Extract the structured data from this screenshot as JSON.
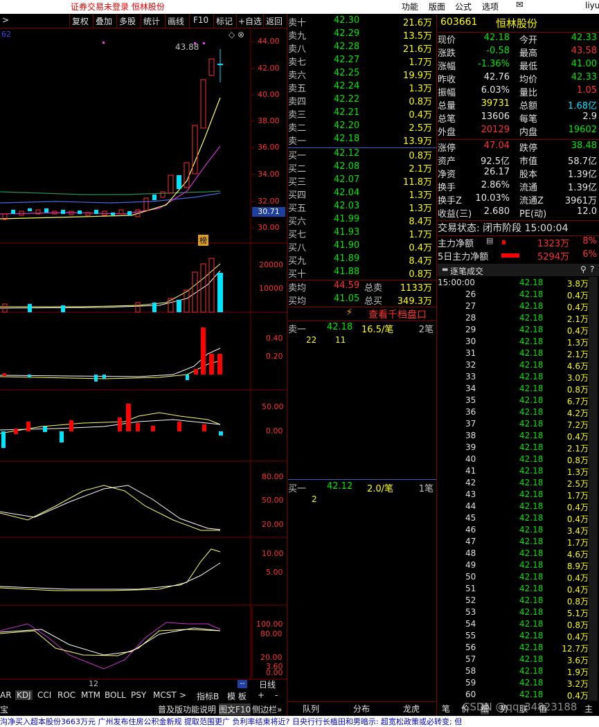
{
  "app": {
    "title": "证券交易未登录  恒林股份",
    "menus": [
      "功能",
      "版面",
      "公式",
      "选项"
    ],
    "user": "liyu"
  },
  "toolbar": {
    "items": [
      ">",
      "复权",
      "叠加",
      "多股",
      "统计",
      "画线",
      "F10",
      "标记",
      "+自选",
      "返回"
    ]
  },
  "chart": {
    "corner_label": "62",
    "price_high_label": "43.88",
    "price_axis": [
      "44.00",
      "42.00",
      "40.00",
      "38.00",
      "36.00",
      "34.00",
      "32.00",
      "30.00"
    ],
    "current_price_tag": "30.71",
    "badge": "榜",
    "volume_axis": [
      "20000",
      "10000"
    ],
    "ind1_axis": [
      "0.40",
      "0.20"
    ],
    "ind2_axis": [
      "50.00",
      "0.00"
    ],
    "ind3_axis": [
      "80.00",
      "50.00",
      "20.00"
    ],
    "ind4_axis": [
      "10.00",
      "5.00"
    ],
    "ind5_axis": [
      "100.00",
      "80.00",
      "20.00",
      "3.60",
      "0.00"
    ],
    "time_label": "12",
    "period_button": "日线",
    "indicator_tabs": [
      "AR",
      "KDJ",
      "CCI",
      "ROC",
      "MTM",
      "BOLL",
      "PSY",
      "MCST",
      ">",
      "指标B",
      "模 板",
      "+",
      "-"
    ],
    "status_tabs": [
      "宝",
      "普及版功能说明",
      "图文F10",
      "侧边栏»"
    ]
  },
  "orderbook": {
    "sell": [
      {
        "label": "卖十",
        "price": "42.30",
        "vol": "21.6万"
      },
      {
        "label": "卖九",
        "price": "42.29",
        "vol": "13.5万"
      },
      {
        "label": "卖八",
        "price": "42.28",
        "vol": "21.6万"
      },
      {
        "label": "卖七",
        "price": "42.27",
        "vol": "1.7万"
      },
      {
        "label": "卖六",
        "price": "42.25",
        "vol": "19.9万"
      },
      {
        "label": "卖五",
        "price": "42.24",
        "vol": "1.3万"
      },
      {
        "label": "卖四",
        "price": "42.22",
        "vol": "0.8万"
      },
      {
        "label": "卖三",
        "price": "42.21",
        "vol": "0.4万"
      },
      {
        "label": "卖二",
        "price": "42.20",
        "vol": "2.5万"
      },
      {
        "label": "卖一",
        "price": "42.18",
        "vol": "13.9万"
      }
    ],
    "buy": [
      {
        "label": "买一",
        "price": "42.12",
        "vol": "0.8万"
      },
      {
        "label": "买二",
        "price": "42.08",
        "vol": "2.1万"
      },
      {
        "label": "买三",
        "price": "42.07",
        "vol": "11.8万"
      },
      {
        "label": "买四",
        "price": "42.04",
        "vol": "1.3万"
      },
      {
        "label": "买五",
        "price": "42.03",
        "vol": "1.3万"
      },
      {
        "label": "买六",
        "price": "41.99",
        "vol": "8.4万"
      },
      {
        "label": "买七",
        "price": "41.93",
        "vol": "1.7万"
      },
      {
        "label": "买八",
        "price": "41.90",
        "vol": "0.4万"
      },
      {
        "label": "买九",
        "price": "41.89",
        "vol": "8.4万"
      },
      {
        "label": "买十",
        "price": "41.88",
        "vol": "0.8万"
      }
    ],
    "sell_avg": {
      "label": "卖均",
      "price": "44.59",
      "total_label": "总卖",
      "total": "1133万"
    },
    "buy_avg": {
      "label": "买均",
      "price": "41.05",
      "total_label": "总买",
      "total": "349.3万"
    },
    "depth_link": "查看千档盘口",
    "sell1_detail": {
      "label": "卖一",
      "price": "42.18",
      "size": "16.5/笔",
      "count": "2笔",
      "orders": [
        "22",
        "11"
      ]
    },
    "buy1_detail": {
      "label": "买一",
      "price": "42.12",
      "size": "2.0/笔",
      "count": "1笔",
      "orders": [
        "2"
      ]
    },
    "tabs": [
      "队列",
      "分布",
      "龙虎"
    ]
  },
  "quote": {
    "code": "603661",
    "name": "恒林股份",
    "rows": [
      [
        {
          "l": "现价",
          "v": "42.18",
          "c": "green"
        },
        {
          "l": "今开",
          "v": "42.33",
          "c": "green"
        }
      ],
      [
        {
          "l": "涨跌",
          "v": "-0.58",
          "c": "green"
        },
        {
          "l": "最高",
          "v": "43.58",
          "c": "red"
        }
      ],
      [
        {
          "l": "涨幅",
          "v": "-1.36%",
          "c": "green"
        },
        {
          "l": "最低",
          "v": "41.00",
          "c": "green"
        }
      ],
      [
        {
          "l": "昨收",
          "v": "42.76",
          "c": "white"
        },
        {
          "l": "均价",
          "v": "42.33",
          "c": "green"
        }
      ],
      [
        {
          "l": "振幅",
          "v": "6.03%",
          "c": "white"
        },
        {
          "l": "量比",
          "v": "1.05",
          "c": "red"
        }
      ],
      [
        {
          "l": "总量",
          "v": "39731",
          "c": "yellow"
        },
        {
          "l": "总额",
          "v": "1.68亿",
          "c": "cyan"
        }
      ],
      [
        {
          "l": "总笔",
          "v": "13606",
          "c": "white"
        },
        {
          "l": "每笔",
          "v": "2.9",
          "c": "white"
        }
      ],
      [
        {
          "l": "外盘",
          "v": "20129",
          "c": "red"
        },
        {
          "l": "内盘",
          "v": "19602",
          "c": "green"
        }
      ],
      [
        {
          "l": "涨停",
          "v": "47.04",
          "c": "red"
        },
        {
          "l": "跌停",
          "v": "38.48",
          "c": "green"
        }
      ],
      [
        {
          "l": "资产",
          "v": "92.5亿",
          "c": "white"
        },
        {
          "l": "市值",
          "v": "58.7亿",
          "c": "white"
        }
      ],
      [
        {
          "l": "净资",
          "v": "26.17",
          "c": "white"
        },
        {
          "l": "股本",
          "v": "1.39亿",
          "c": "white"
        }
      ],
      [
        {
          "l": "换手",
          "v": "2.86%",
          "c": "white"
        },
        {
          "l": "流通",
          "v": "1.39亿",
          "c": "white"
        }
      ],
      [
        {
          "l": "换手Z",
          "v": "10.03%",
          "c": "white"
        },
        {
          "l": "流通Z",
          "v": "3961万",
          "c": "white"
        }
      ],
      [
        {
          "l": "收益(三)",
          "v": "2.680",
          "c": "white"
        },
        {
          "l": "PE(动)",
          "v": "12.0",
          "c": "white"
        }
      ]
    ],
    "trade_status": "交易状态: 闭市阶段 15:00:04",
    "main_net": {
      "label": "主力净额",
      "value": "1323万",
      "pct": "8%"
    },
    "main_net5": {
      "label": "5日主力净额",
      "value": "5294万",
      "pct": "6%"
    },
    "ticks_title": "逐笔成交",
    "ticks": [
      [
        "15:00:00",
        "42.18",
        "3.8万"
      ],
      [
        "26",
        "42.18",
        "0.4万"
      ],
      [
        "27",
        "42.18",
        "0.4万"
      ],
      [
        "28",
        "42.18",
        "2.1万"
      ],
      [
        "29",
        "42.18",
        "0.4万"
      ],
      [
        "30",
        "42.18",
        "1.3万"
      ],
      [
        "31",
        "42.18",
        "2.1万"
      ],
      [
        "32",
        "42.18",
        "4.6万"
      ],
      [
        "33",
        "42.18",
        "3.0万"
      ],
      [
        "34",
        "42.18",
        "0.8万"
      ],
      [
        "35",
        "42.18",
        "6.7万"
      ],
      [
        "36",
        "42.18",
        "4.2万"
      ],
      [
        "37",
        "42.18",
        "7.2万"
      ],
      [
        "38",
        "42.18",
        "0.4万"
      ],
      [
        "39",
        "42.18",
        "2.1万"
      ],
      [
        "40",
        "42.18",
        "0.8万"
      ],
      [
        "41",
        "42.18",
        "1.3万"
      ],
      [
        "42",
        "42.18",
        "2.5万"
      ],
      [
        "43",
        "42.18",
        "1.7万"
      ],
      [
        "44",
        "42.18",
        "0.4万"
      ],
      [
        "45",
        "42.18",
        "0.4万"
      ],
      [
        "46",
        "42.18",
        "3.4万"
      ],
      [
        "47",
        "42.18",
        "1.7万"
      ],
      [
        "48",
        "42.18",
        "4.6万"
      ],
      [
        "49",
        "42.18",
        "8.9万"
      ],
      [
        "50",
        "42.18",
        "0.4万"
      ],
      [
        "51",
        "42.18",
        "0.4万"
      ],
      [
        "52",
        "42.18",
        "0.8万"
      ],
      [
        "53",
        "42.18",
        "5.1万"
      ],
      [
        "54",
        "42.18",
        "0.8万"
      ],
      [
        "55",
        "42.18",
        "0.4万"
      ],
      [
        "56",
        "42.18",
        "12.7万"
      ],
      [
        "57",
        "42.18",
        "3.6万"
      ],
      [
        "58",
        "42.18",
        "1.9万"
      ],
      [
        "59",
        "42.18",
        "3.2万"
      ],
      [
        "60",
        "42.18",
        "0.4万"
      ]
    ],
    "bottom_tabs": [
      "笔",
      "价",
      "细",
      "势",
      "联",
      "值",
      "主"
    ]
  },
  "ticker": "沟净买入超本股份3663万元      广州发布住房公积金新规 提取范围更广      负利率结束将近? 日央行行长植田和男暗示: 超宽松政策或必转变; 但      ",
  "watermark": "CSDN @qq_34823188"
}
